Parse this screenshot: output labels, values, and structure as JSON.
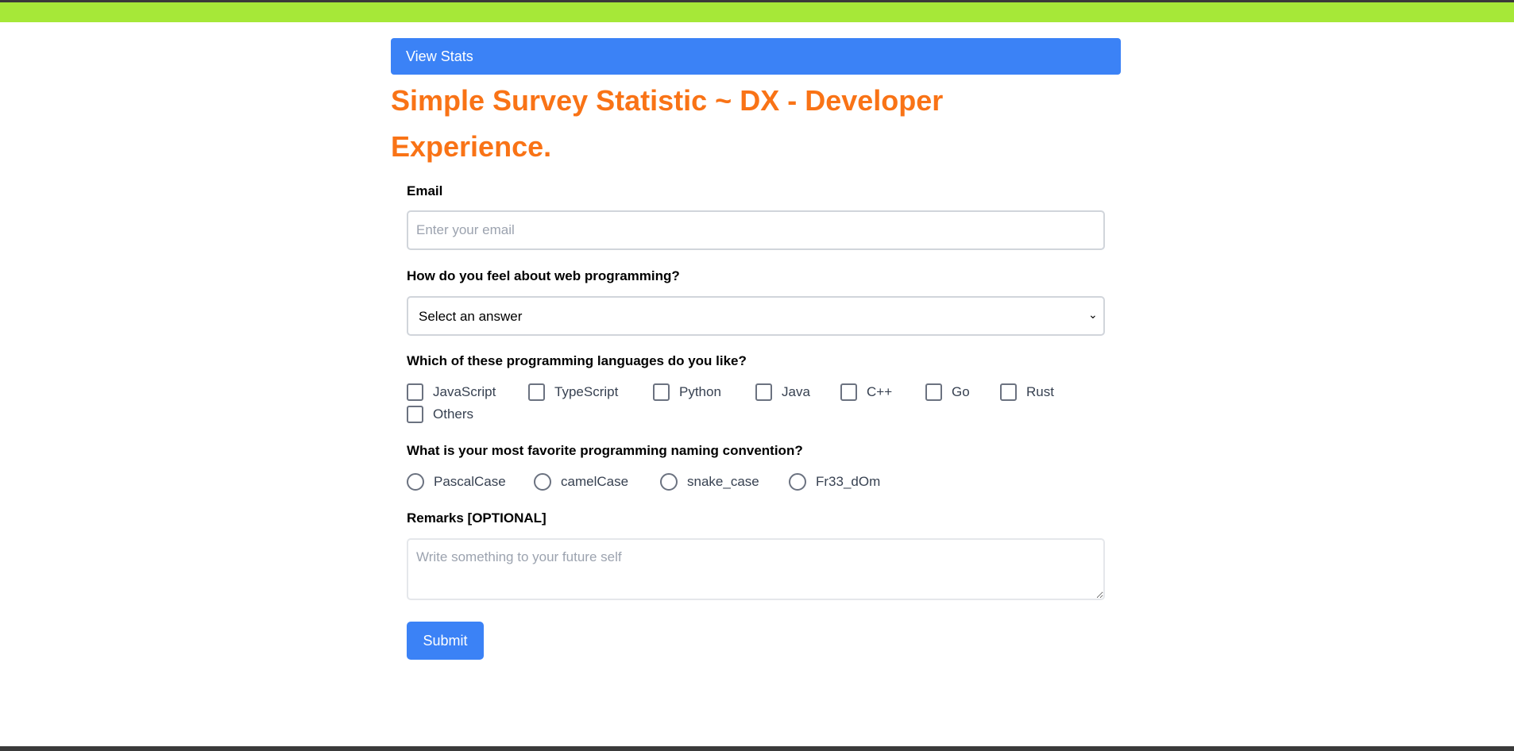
{
  "nav": {
    "view_stats_label": "View Stats"
  },
  "title": "Simple Survey Statistic ~ DX - Developer Experience.",
  "form": {
    "email": {
      "label": "Email",
      "placeholder": "Enter your email",
      "value": ""
    },
    "feeling": {
      "label": "How do you feel about web programming?",
      "selected": "Select an answer"
    },
    "languages": {
      "label": "Which of these programming languages do you like?",
      "options": [
        "JavaScript",
        "TypeScript",
        "Python",
        "Java",
        "C++",
        "Go",
        "Rust",
        "Others"
      ]
    },
    "naming": {
      "label": "What is your most favorite programming naming convention?",
      "options": [
        "PascalCase",
        "camelCase",
        "snake_case",
        "Fr33_dOm"
      ]
    },
    "remarks": {
      "label": "Remarks [OPTIONAL]",
      "placeholder": "Write something to your future self",
      "value": ""
    },
    "submit_label": "Submit"
  },
  "colors": {
    "top_bar": "#a6e838",
    "accent": "#3b82f6",
    "title": "#f97316"
  }
}
